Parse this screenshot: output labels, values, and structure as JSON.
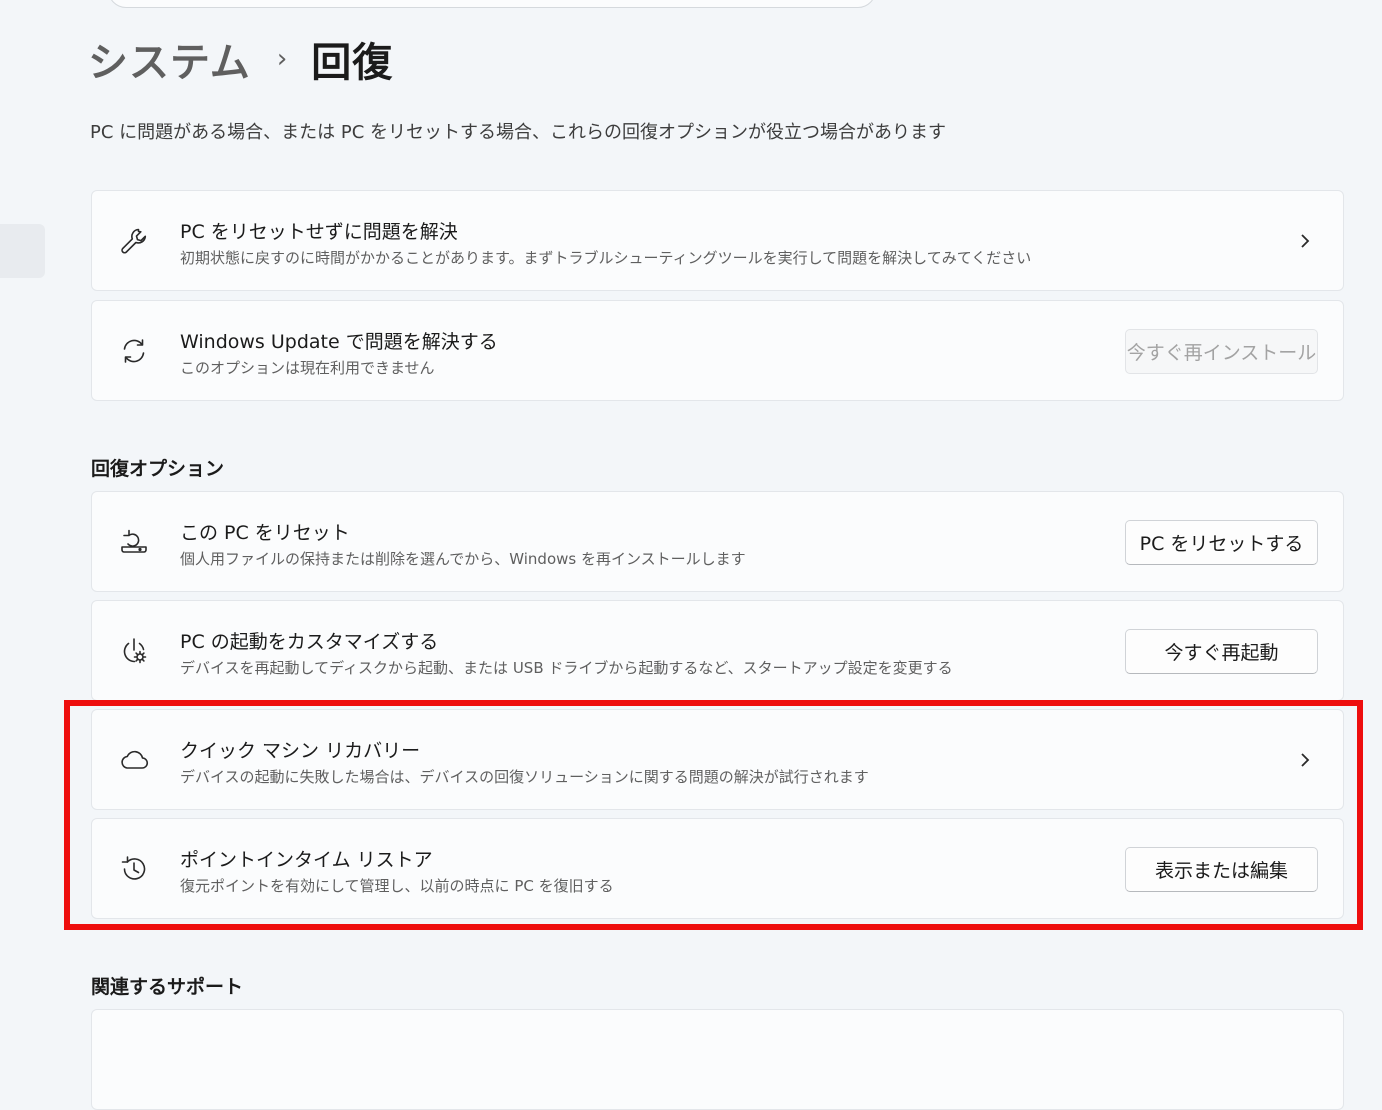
{
  "breadcrumb": {
    "parent": "システム",
    "separator": "›",
    "current": "回復"
  },
  "intro": "PC に問題がある場合、または PC をリセットする場合、これらの回復オプションが役立つ場合があります",
  "top_cards": [
    {
      "title": "PC をリセットせずに問題を解決",
      "description": "初期状態に戻すのに時間がかかることがあります。まずトラブルシューティングツールを実行して問題を解決してみてください",
      "icon": "wrench-icon"
    },
    {
      "title": "Windows Update で問題を解決する",
      "description": "このオプションは現在利用できません",
      "button": "今すぐ再インストール",
      "icon": "sync-icon"
    }
  ],
  "recovery_options": {
    "heading": "回復オプション",
    "items": [
      {
        "title": "この PC をリセット",
        "description": "個人用ファイルの保持または削除を選んでから、Windows を再インストールします",
        "button": "PC をリセットする",
        "icon": "reset-pc-icon"
      },
      {
        "title": "PC の起動をカスタマイズする",
        "description": "デバイスを再起動してディスクから起動、または USB ドライブから起動するなど、スタートアップ設定を変更する",
        "button": "今すぐ再起動",
        "icon": "power-gear-icon"
      },
      {
        "title": "クイック マシン リカバリー",
        "description": "デバイスの起動に失敗した場合は、デバイスの回復ソリューションに関する問題の解決が試行されます",
        "icon": "cloud-icon"
      },
      {
        "title": "ポイントインタイム リストア",
        "description": "復元ポイントを有効にして管理し、以前の時点に PC を復旧する",
        "button": "表示または編集",
        "icon": "history-icon"
      }
    ]
  },
  "related_support": {
    "heading": "関連するサポート"
  },
  "colors": {
    "highlight": "#ee0e0e",
    "background": "#f3f6f9",
    "card": "#fbfcfd"
  }
}
